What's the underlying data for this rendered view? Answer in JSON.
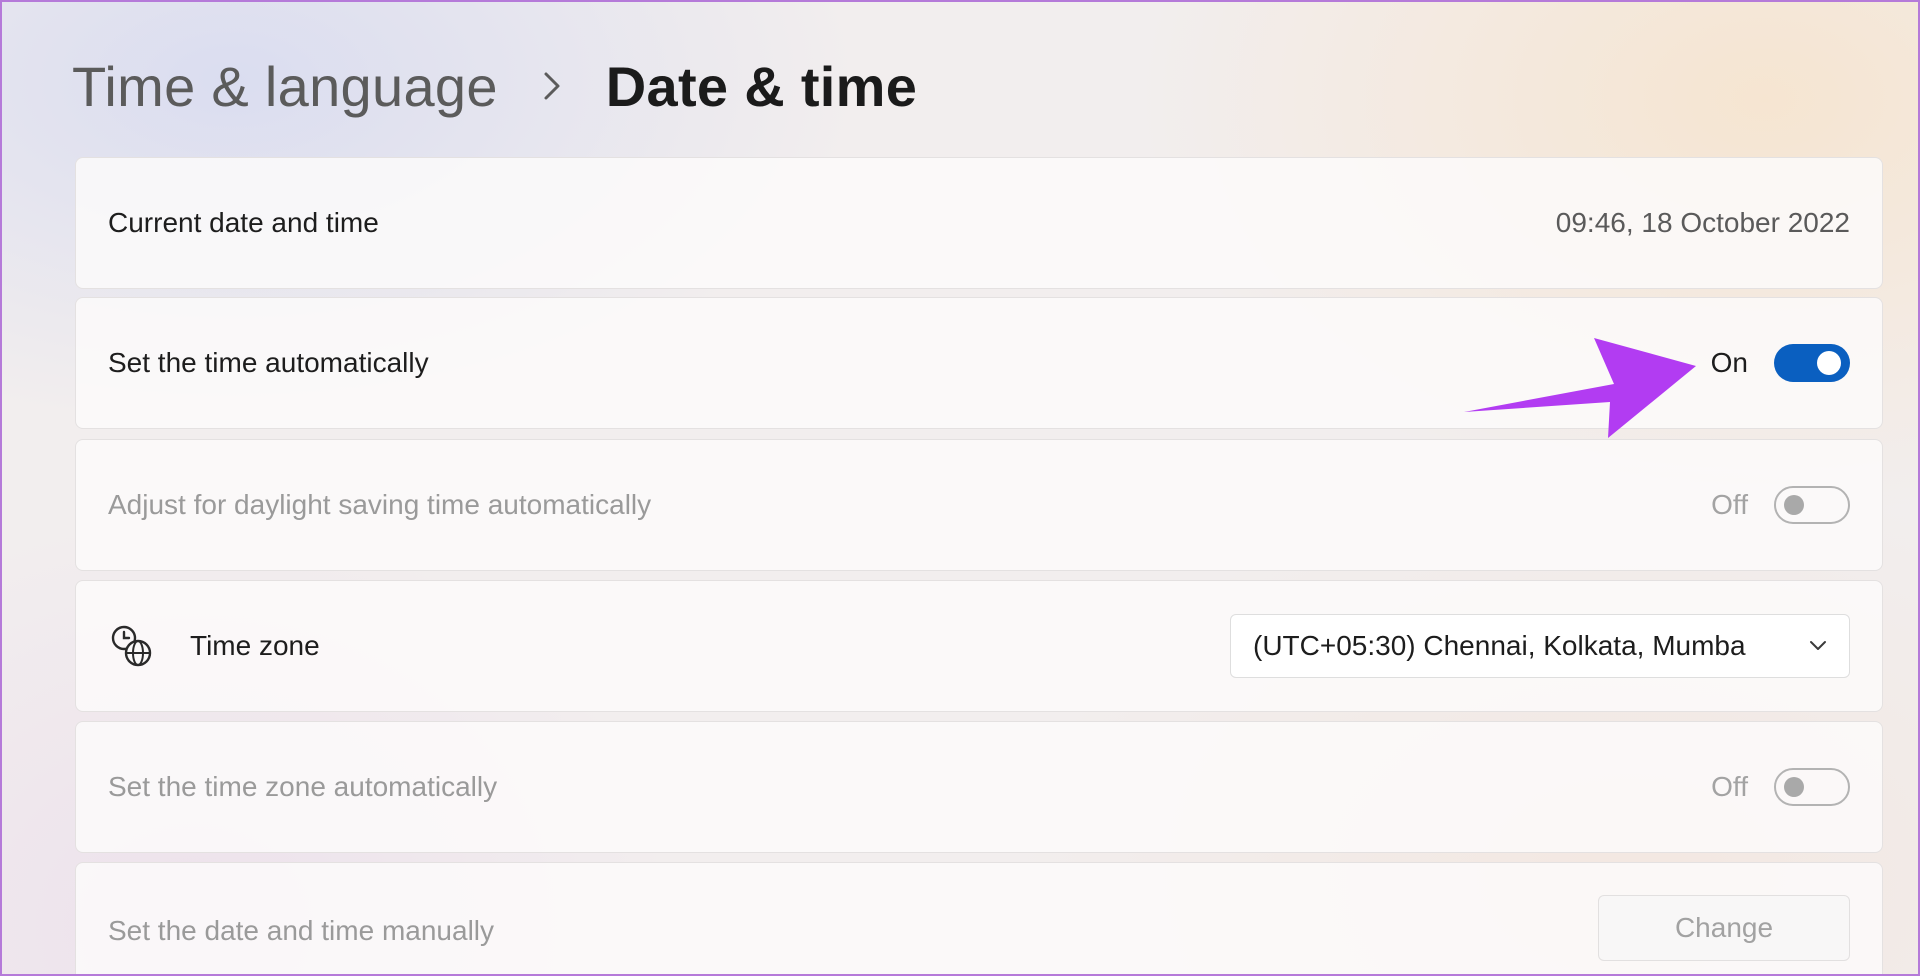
{
  "breadcrumb": {
    "parent": "Time & language",
    "current": "Date & time"
  },
  "settings": {
    "current_date_time": {
      "label": "Current date and time",
      "value": "09:46, 18 October 2022"
    },
    "set_time_auto": {
      "label": "Set the time automatically",
      "state": "On",
      "enabled": true
    },
    "daylight_saving": {
      "label": "Adjust for daylight saving time automatically",
      "state": "Off",
      "enabled": false
    },
    "time_zone": {
      "label": "Time zone",
      "icon": "clock-globe-icon",
      "selected": "(UTC+05:30) Chennai, Kolkata, Mumba"
    },
    "time_zone_auto": {
      "label": "Set the time zone automatically",
      "state": "Off",
      "enabled": false
    },
    "manual": {
      "label": "Set the date and time manually",
      "button": "Change"
    }
  },
  "colors": {
    "accent": "#0a5fc0",
    "annotation_arrow": "#b23cf2",
    "frame_border": "#b57ad9"
  }
}
